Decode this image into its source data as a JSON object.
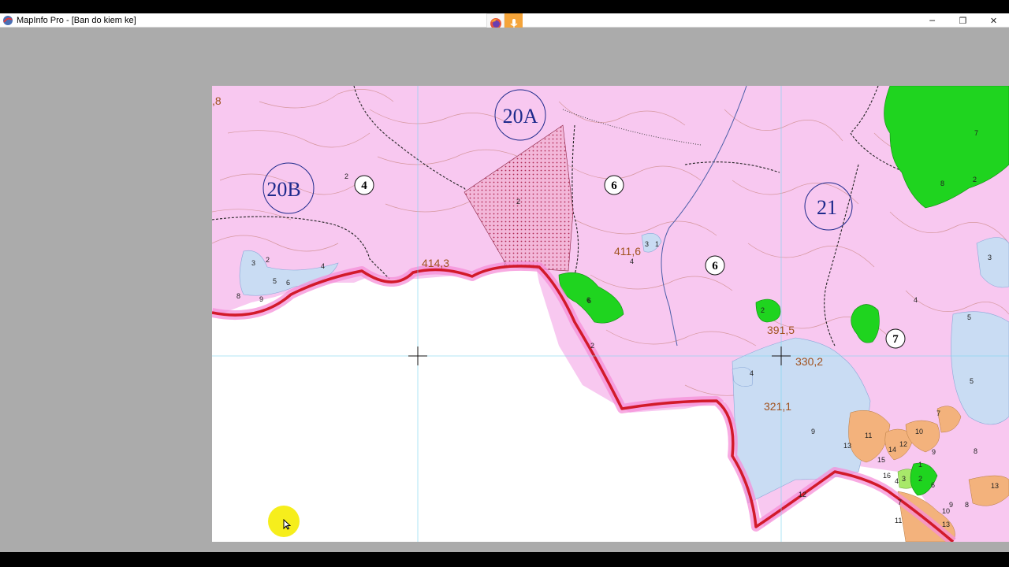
{
  "window": {
    "title": "MapInfo Pro - [Ban do kiem ke]",
    "controls": {
      "minimize": "─",
      "restore": "❐",
      "close": "✕"
    }
  },
  "extensions": {
    "browser_icon": "firefox-icon",
    "mic_icon": "microphone-icon"
  },
  "map": {
    "compartment_labels": {
      "c20a": "20A",
      "c20b": "20B",
      "c21": "21"
    },
    "subcompartment_labels": {
      "s4": "4",
      "s6a": "6",
      "s6b": "6",
      "s7": "7"
    },
    "elevations": {
      "e414": "414,3",
      "e411": "411,6",
      "e391": "391,5",
      "e330": "330,2",
      "e321": "321,1",
      "e8": ",8"
    },
    "lot_numbers": {
      "n1": "2",
      "n2": "2",
      "n3": "3",
      "n4": "2",
      "n5": "5",
      "n6": "6",
      "n7": "4",
      "n8": "8",
      "n9": "9",
      "n10": "3",
      "n11": "1",
      "n12": "4",
      "n13": "2",
      "n14": "4",
      "n15": "4",
      "n16": "6",
      "n17": "7",
      "n18": "8",
      "n19": "2",
      "n20": "3",
      "n21": "5",
      "n22": "5",
      "n23": "7",
      "n24": "9",
      "n25": "10",
      "n26": "11",
      "n27": "14",
      "n28": "12",
      "n29": "13",
      "n30": "15",
      "n31": "1",
      "n32": "9",
      "n33": "8",
      "n34": "16",
      "n35": "4",
      "n36": "3",
      "n37": "2",
      "n38": "6",
      "n39": "9",
      "n40": "8",
      "n41": "10",
      "n42": "13",
      "n43": "7",
      "n44": "11",
      "n45": "13",
      "n46": "12",
      "n47": "6",
      "n48": "2"
    },
    "colors": {
      "forest_land": "#f8c8f0",
      "boundary": "#d21a2a",
      "boundary_glow": "#f58fd8",
      "green_patch": "#1fd41f",
      "water_patch": "#c9dcf3",
      "orange_patch": "#f3b27c",
      "label_circle": "#1e2a8c"
    }
  }
}
